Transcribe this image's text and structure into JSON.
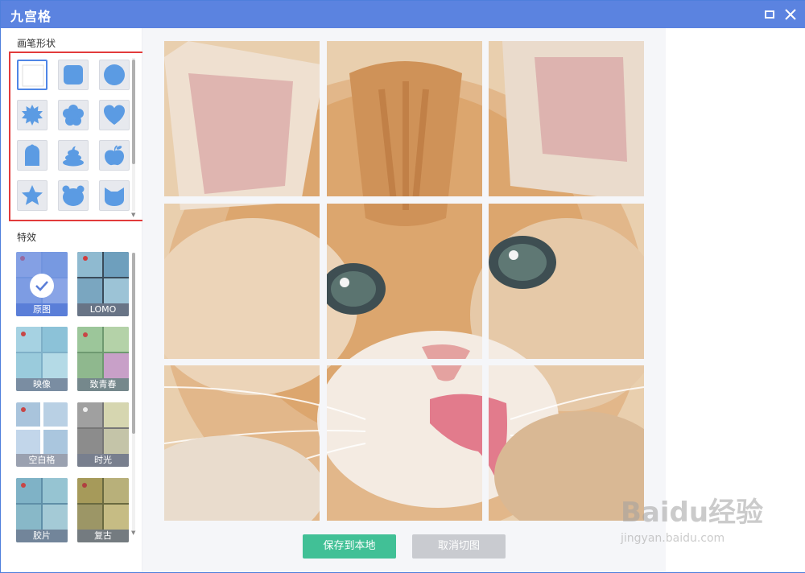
{
  "window": {
    "title": "九宫格"
  },
  "sidebar": {
    "brush_label": "画笔形状",
    "brush_shapes": [
      "square",
      "rounded-square",
      "circle",
      "burst",
      "flower",
      "heart",
      "tombstone",
      "poop",
      "apple",
      "star",
      "bear",
      "cat"
    ],
    "selected_shape": "square",
    "effects_label": "特效",
    "effects": [
      {
        "label": "原图",
        "selected": true
      },
      {
        "label": "LOMO",
        "selected": false
      },
      {
        "label": "映像",
        "selected": false
      },
      {
        "label": "致青春",
        "selected": false
      },
      {
        "label": "空白格",
        "selected": false
      },
      {
        "label": "时光",
        "selected": false
      },
      {
        "label": "胶片",
        "selected": false
      },
      {
        "label": "复古",
        "selected": false
      }
    ]
  },
  "main": {
    "image_subject": "kitten",
    "grid": "3x3",
    "save_label": "保存到本地",
    "cancel_label": "取消切图"
  },
  "watermark": {
    "main": "Baidu经验",
    "sub": "jingyan.baidu.com"
  },
  "colors": {
    "titlebar": "#5b83e0",
    "save": "#41c096",
    "cancel": "#c9cbd0",
    "highlight": "#e23b3b",
    "shape": "#5b9be3"
  }
}
